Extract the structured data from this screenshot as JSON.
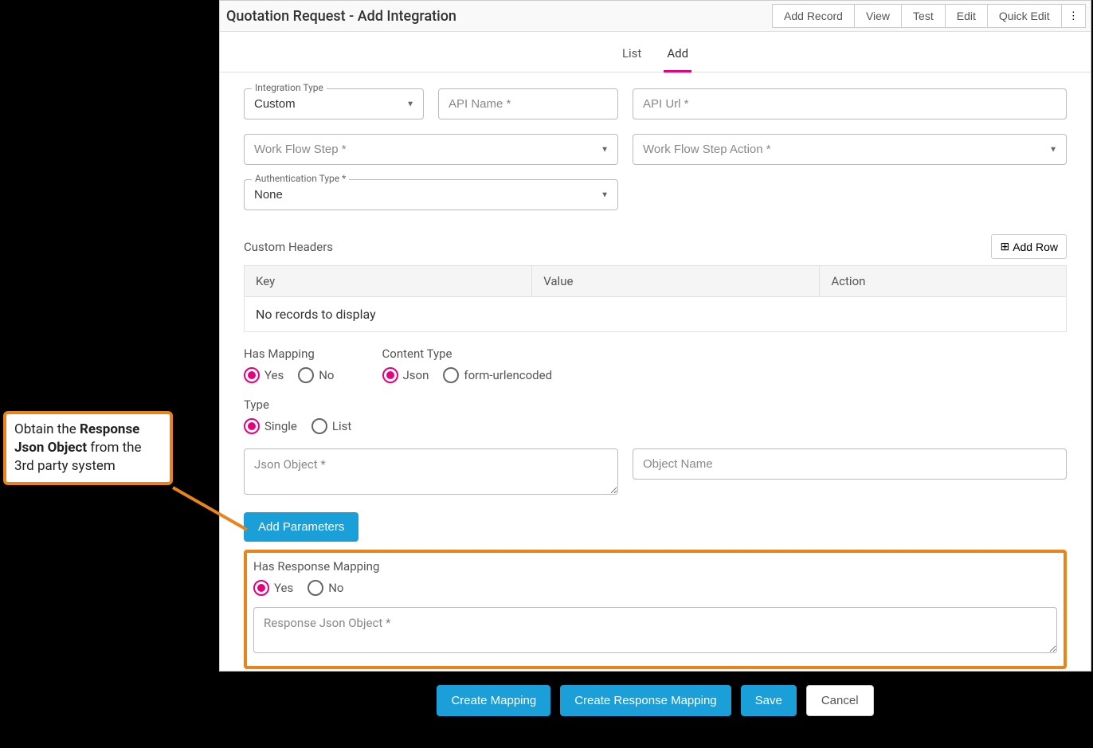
{
  "header": {
    "title": "Quotation Request - Add Integration",
    "buttons": [
      "Add Record",
      "View",
      "Test",
      "Edit",
      "Quick Edit"
    ]
  },
  "tabs": {
    "list": "List",
    "add": "Add"
  },
  "fields": {
    "integrationType": {
      "label": "Integration Type",
      "value": "Custom"
    },
    "apiName": {
      "placeholder": "API Name *"
    },
    "apiUrl": {
      "placeholder": "API Url *"
    },
    "workFlowStep": {
      "placeholder": "Work Flow Step *"
    },
    "workFlowStepAction": {
      "placeholder": "Work Flow Step Action *"
    },
    "authType": {
      "label": "Authentication Type *",
      "value": "None"
    },
    "customHeaders": {
      "label": "Custom Headers",
      "addRow": "Add Row"
    },
    "table": {
      "cols": [
        "Key",
        "Value",
        "Action"
      ],
      "empty": "No records to display"
    },
    "hasMapping": {
      "label": "Has Mapping",
      "yes": "Yes",
      "no": "No"
    },
    "contentType": {
      "label": "Content Type",
      "json": "Json",
      "form": "form-urlencoded"
    },
    "type": {
      "label": "Type",
      "single": "Single",
      "list": "List"
    },
    "jsonObject": {
      "placeholder": "Json Object *"
    },
    "objectName": {
      "placeholder": "Object Name"
    },
    "addParameters": "Add Parameters",
    "hasResponseMapping": {
      "label": "Has Response Mapping",
      "yes": "Yes",
      "no": "No"
    },
    "responseJsonObject": {
      "placeholder": "Response Json Object *"
    }
  },
  "footer": {
    "createMapping": "Create Mapping",
    "createResponseMapping": "Create Response Mapping",
    "save": "Save",
    "cancel": "Cancel"
  },
  "annotation": {
    "prefix": "Obtain the ",
    "bold": "Response Json Object",
    "suffix": " from the 3rd party system"
  }
}
